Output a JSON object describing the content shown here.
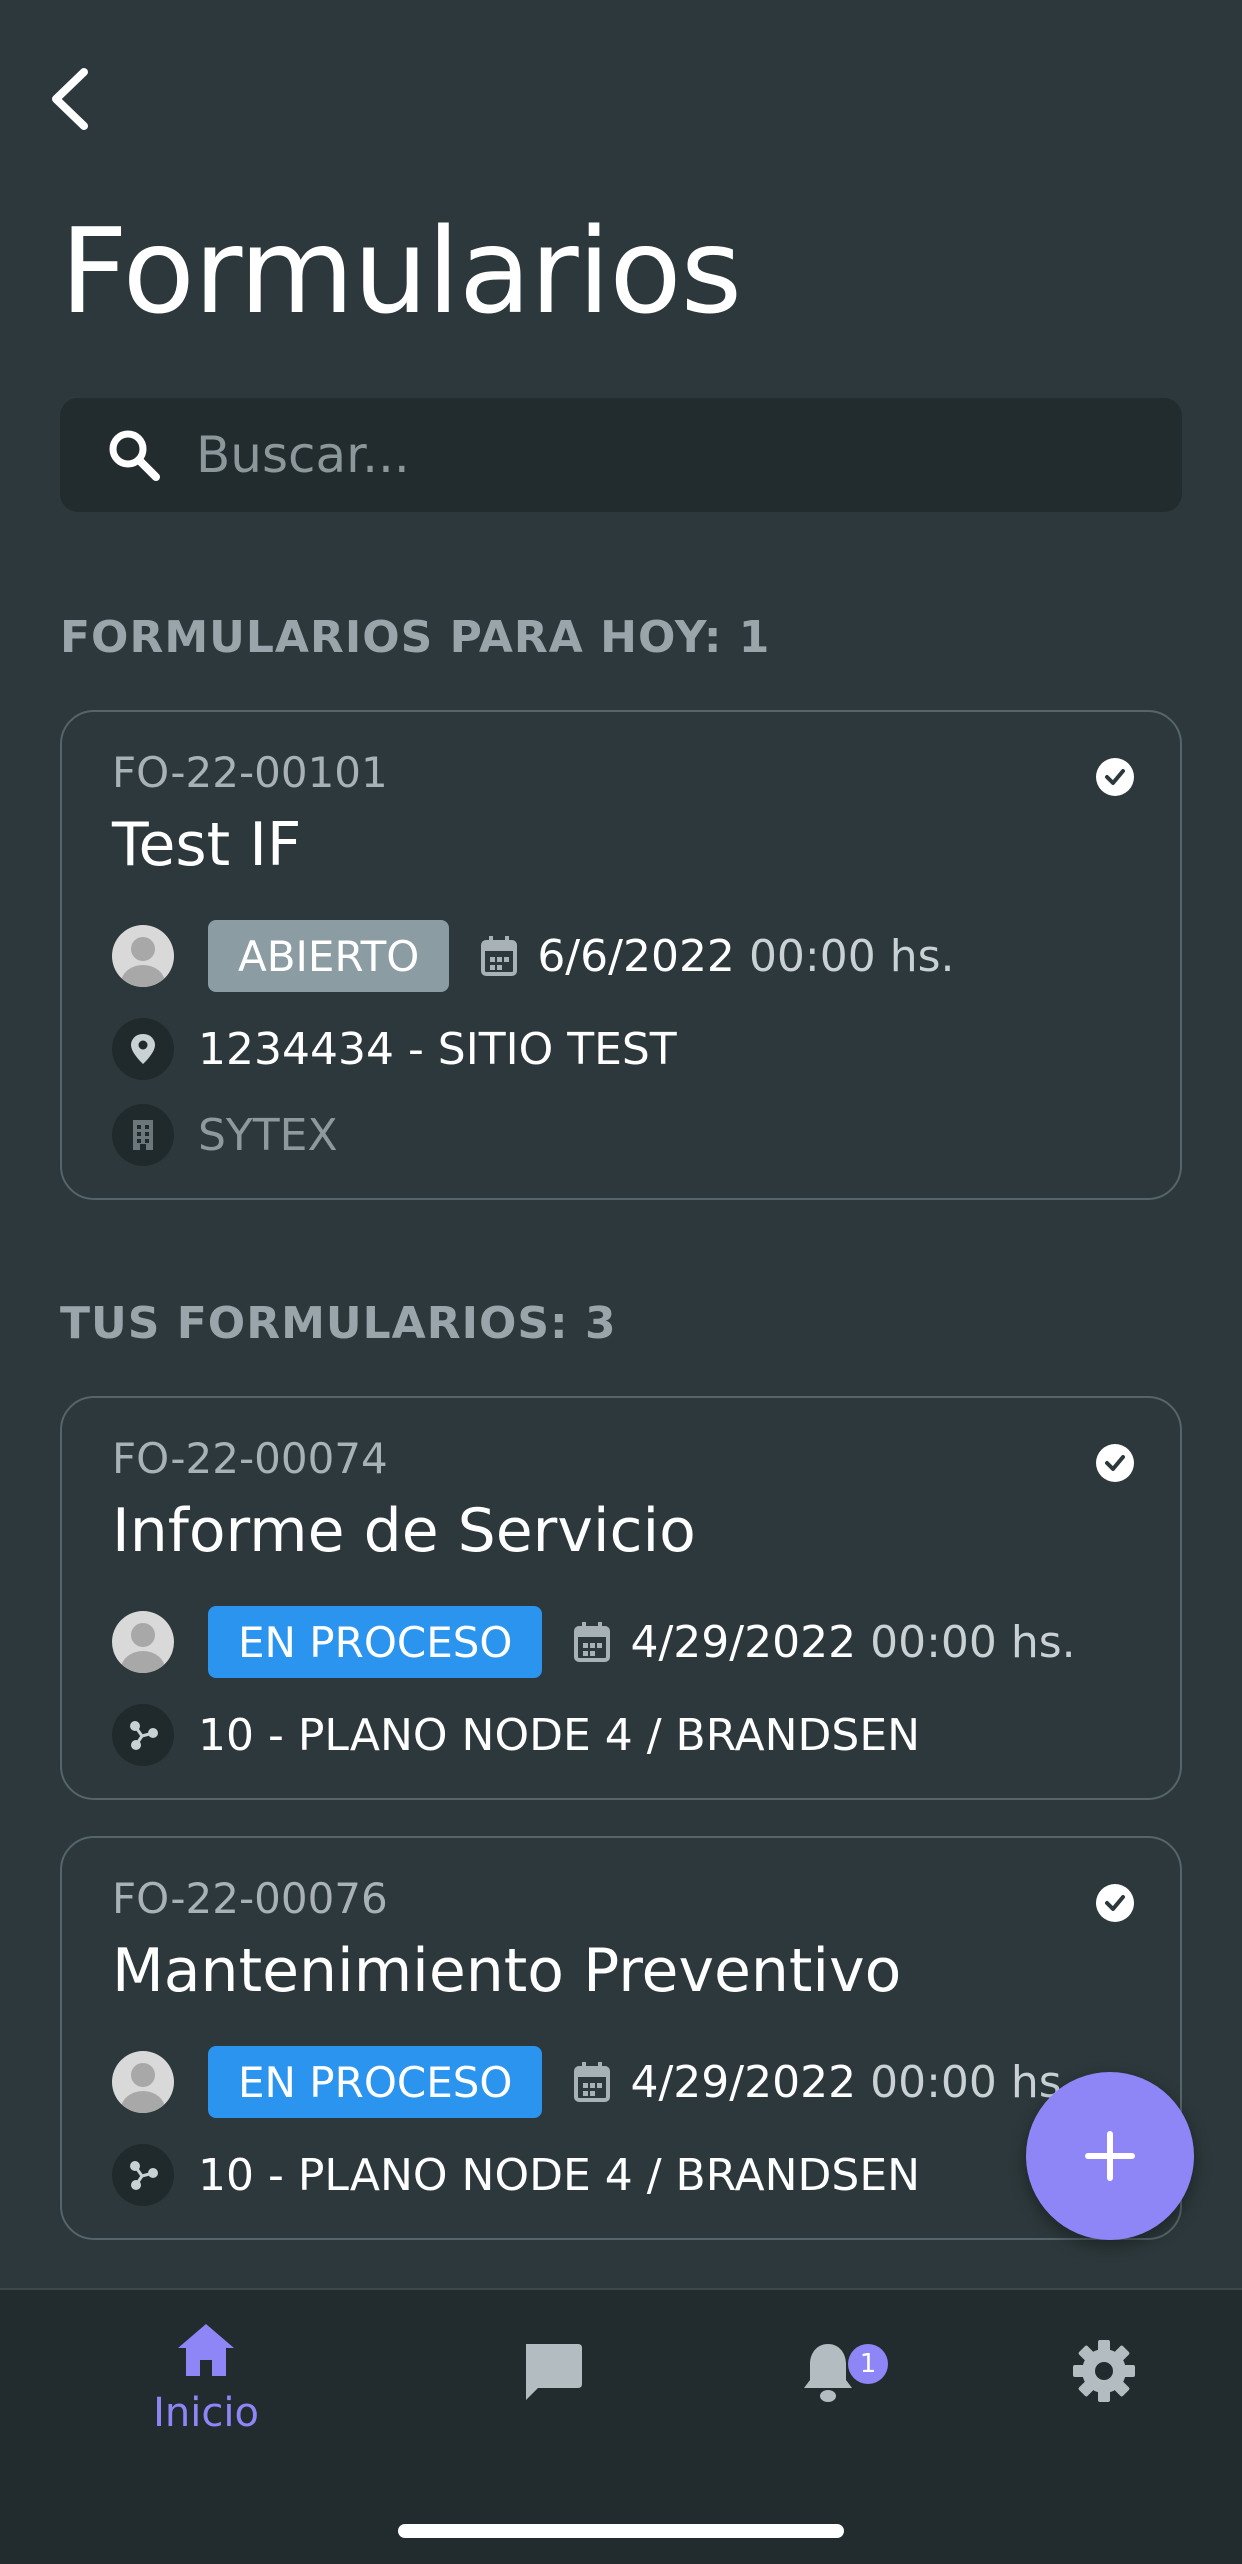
{
  "header": {
    "title": "Formularios"
  },
  "search": {
    "placeholder": "Buscar..."
  },
  "sections": {
    "today": {
      "label": "FORMULARIOS PARA HOY: 1"
    },
    "yours": {
      "label": "TUS FORMULARIOS: 3"
    }
  },
  "cards": [
    {
      "code": "FO-22-00101",
      "title": "Test IF",
      "status": "ABIERTO",
      "date": "6/6/2022",
      "time": "00:00 hs.",
      "location": "1234434 - SITIO TEST",
      "company": "SYTEX"
    },
    {
      "code": "FO-22-00074",
      "title": "Informe de Servicio",
      "status": "EN PROCESO",
      "date": "4/29/2022",
      "time": "00:00 hs.",
      "location": "10 - PLANO NODE 4 / BRANDSEN"
    },
    {
      "code": "FO-22-00076",
      "title": "Mantenimiento Preventivo",
      "status": "EN PROCESO",
      "date": "4/29/2022",
      "time": "00:00 hs.",
      "location": "10 - PLANO NODE 4 / BRANDSEN"
    }
  ],
  "nav": {
    "home_label": "Inicio",
    "notification_count": "1"
  },
  "colors": {
    "background": "#2c383b",
    "accent": "#8e86f7",
    "status_open": "#8b9ca3",
    "status_in_progress": "#2b94ee"
  }
}
